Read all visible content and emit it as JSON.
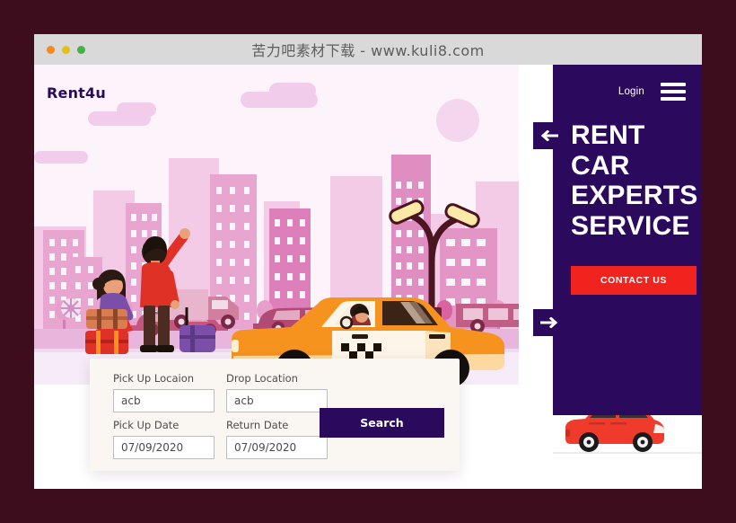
{
  "window": {
    "title": "苦力吧素材下载 - www.kuli8.com",
    "traffic_lights": [
      "close",
      "minimize",
      "maximize"
    ]
  },
  "site": {
    "logo": "Rent4u"
  },
  "nav": {
    "login_label": "Login",
    "menu_icon": "hamburger-menu-icon"
  },
  "hero": {
    "heading_line1": "RENT CAR",
    "heading_line2": "EXPERTS",
    "heading_line3": "SERVICE",
    "cta_label": "CONTACT US",
    "prev_icon": "arrow-left-icon",
    "next_icon": "arrow-right-icon"
  },
  "search_form": {
    "pickup_location": {
      "label": "Pick Up Locaion",
      "value": "acb",
      "placeholder": "acb"
    },
    "drop_location": {
      "label": "Drop Location",
      "value": "acb",
      "placeholder": "acb"
    },
    "pickup_date": {
      "label": "Pick Up Date",
      "value": "07/09/2020",
      "placeholder": "07/09/2020"
    },
    "return_date": {
      "label": "Return Date",
      "value": "07/09/2020",
      "placeholder": "07/09/2020"
    },
    "search_label": "Search"
  },
  "colors": {
    "page_background": "#3d0d1e",
    "title_bar": "#d9d9d9",
    "panel_purple": "#2b0a5e",
    "cta_red": "#f0231f",
    "taxi_orange": "#f5931e",
    "car_red": "#ef3b2c",
    "form_bg": "#faf7f2"
  },
  "illustration": {
    "name": "city-street-taxi-scene",
    "elements": [
      "skyline",
      "sun",
      "clouds",
      "street-lamp",
      "trees",
      "taxi",
      "taxi-driver",
      "traveler-man",
      "traveler-woman",
      "luggage",
      "background-cars"
    ]
  }
}
